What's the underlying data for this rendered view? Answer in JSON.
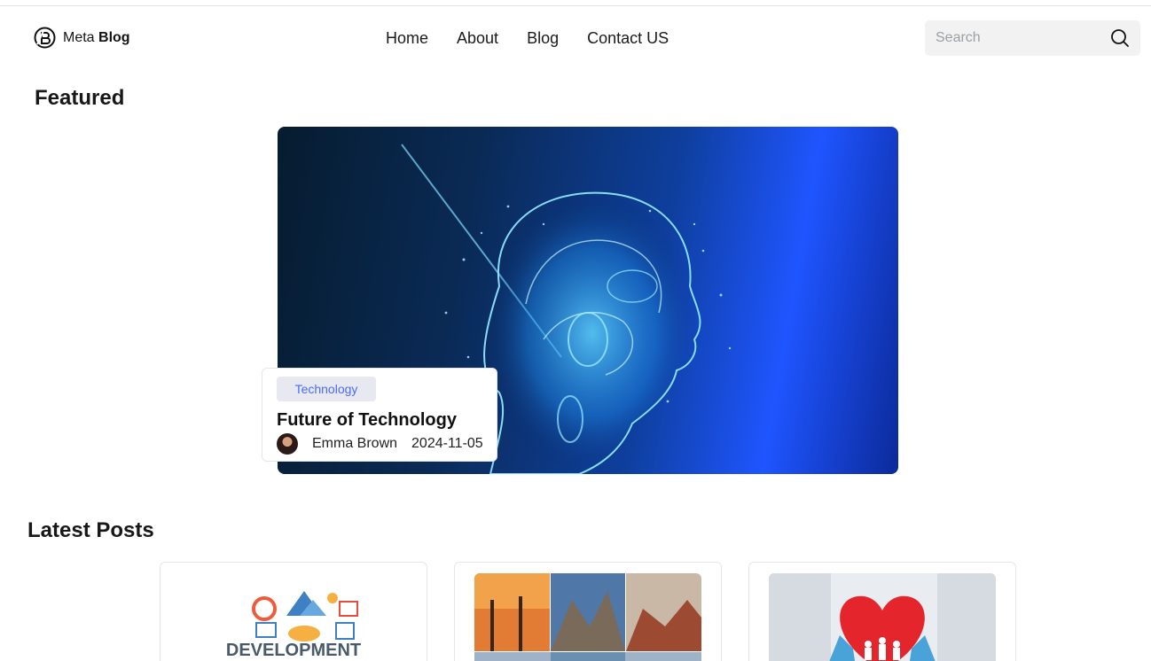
{
  "header": {
    "logo": {
      "prefix": "Meta",
      "bold": "Blog"
    },
    "nav": [
      "Home",
      "About",
      "Blog",
      "Contact US"
    ],
    "search": {
      "placeholder": "Search",
      "value": ""
    }
  },
  "featured": {
    "section_title": "Featured",
    "tag": "Technology",
    "title": "Future of Technology",
    "author": "Emma Brown",
    "date": "2024-11-05"
  },
  "latest": {
    "section_title": "Latest Posts",
    "posts": [
      {
        "image": "development-illustration",
        "image_text": "DEVELOPMENT"
      },
      {
        "image": "travel-landscapes-collage"
      },
      {
        "image": "heart-in-gloved-hands"
      }
    ]
  },
  "icons": {
    "logo": "blog-logo-icon",
    "search": "search-icon"
  }
}
